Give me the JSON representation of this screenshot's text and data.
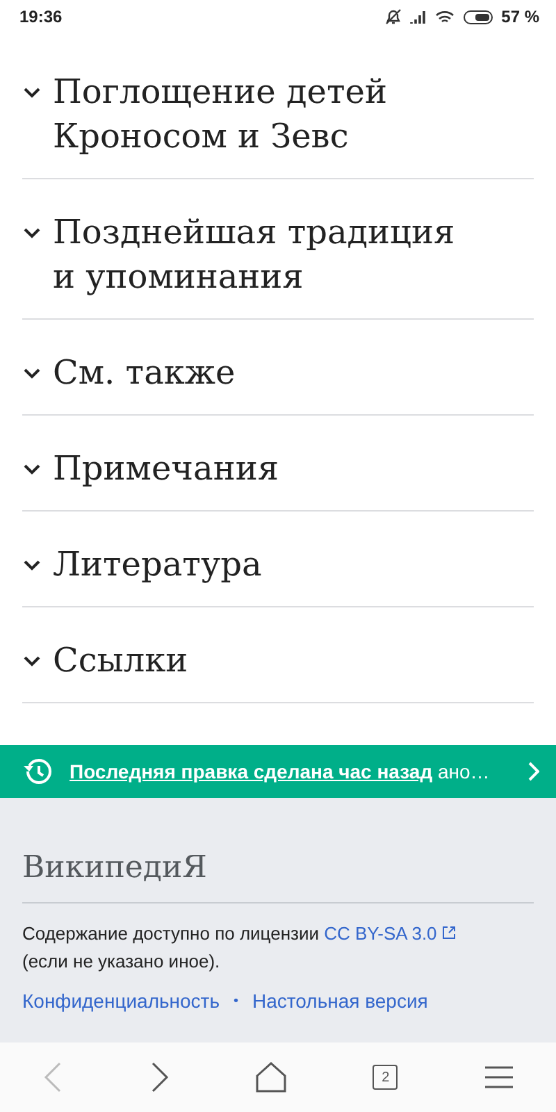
{
  "status_bar": {
    "time": "19:36",
    "battery": "57 %"
  },
  "sections": [
    {
      "title": "Поглощение детей Кроносом и Зевс"
    },
    {
      "title": "Позднейшая традиция и упоминания"
    },
    {
      "title": "См. также"
    },
    {
      "title": "Примечания"
    },
    {
      "title": "Литература"
    },
    {
      "title": "Ссылки"
    }
  ],
  "last_edit": {
    "link": "Последняя правка сделана час назад",
    "rest": "ано…"
  },
  "footer": {
    "logo": "ВикипедиЯ",
    "license_text": "Содержание доступно по лицензии",
    "license_link": "CC BY-SA 3.0",
    "license_note": "(если не указано иное).",
    "links": [
      "Конфиденциальность",
      "Настольная версия"
    ],
    "separator": "•"
  },
  "nav_bar": {
    "buttons": [
      {
        "kind": "back",
        "disabled": true
      },
      {
        "kind": "forward",
        "disabled": false
      },
      {
        "kind": "home",
        "disabled": false
      },
      {
        "kind": "tabs",
        "count": "2",
        "disabled": false
      },
      {
        "kind": "menu",
        "disabled": false
      }
    ]
  }
}
